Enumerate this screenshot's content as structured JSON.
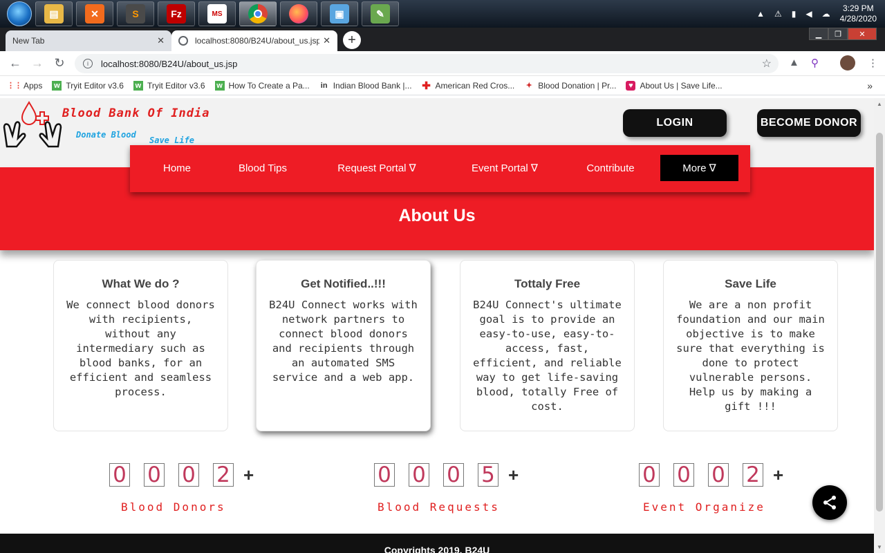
{
  "taskbar": {
    "apps": [
      {
        "name": "file-explorer-icon",
        "color": "#e8b847"
      },
      {
        "name": "xampp-icon",
        "color": "#f26b1d"
      },
      {
        "name": "sublime-icon",
        "color": "#4a4a4a"
      },
      {
        "name": "filezilla-icon",
        "color": "#bf0000"
      },
      {
        "name": "ms-app-icon",
        "color": "#1c1c1c"
      },
      {
        "name": "chrome-icon",
        "color": "#4285f4"
      },
      {
        "name": "firefox-icon",
        "color": "#ff7139"
      },
      {
        "name": "virtualbox-icon",
        "color": "#5aa6e0"
      },
      {
        "name": "paint-icon",
        "color": "#6aa84f"
      }
    ],
    "clock_time": "3:29 PM",
    "clock_date": "4/28/2020"
  },
  "browser": {
    "tabs": [
      {
        "label": "New Tab"
      },
      {
        "label": "localhost:8080/B24U/about_us.jsp"
      }
    ],
    "url": "localhost:8080/B24U/about_us.jsp",
    "bookmarks": [
      {
        "label": "Apps",
        "icon": "apps-grid-icon",
        "color": "#e94235"
      },
      {
        "label": "Tryit Editor v3.6",
        "icon": "w3-icon",
        "color": "#4caf50"
      },
      {
        "label": "Tryit Editor v3.6",
        "icon": "w3-icon",
        "color": "#4caf50"
      },
      {
        "label": "How To Create a Pa...",
        "icon": "w3-icon",
        "color": "#4caf50"
      },
      {
        "label": "Indian Blood Bank |...",
        "icon": "in-icon",
        "color": "#222222"
      },
      {
        "label": "American Red Cros...",
        "icon": "red-cross-icon",
        "color": "#e02020"
      },
      {
        "label": "Blood Donation | Pr...",
        "icon": "blood-donation-icon",
        "color": "#d32f2f"
      },
      {
        "label": "About Us | Save Life...",
        "icon": "save-life-icon",
        "color": "#d81b60"
      }
    ]
  },
  "site": {
    "brand_title": "Blood Bank Of India",
    "tag_donate": "Donate Blood",
    "tag_save": "Save Life",
    "login_label": "LOGIN",
    "donor_label": "BECOME DONOR",
    "nav": [
      {
        "label": "Home"
      },
      {
        "label": "Blood Tips"
      },
      {
        "label": "Request Portal ∇"
      },
      {
        "label": "Event Portal ∇"
      },
      {
        "label": "Contribute"
      },
      {
        "label": "More ∇"
      }
    ],
    "page_title": "About Us",
    "cards": [
      {
        "title": "What We do ?",
        "text": "We connect blood donors with recipients, without any intermediary such as blood banks, for an efficient and seamless process."
      },
      {
        "title": "Get Notified..!!!",
        "text": "B24U Connect works with network partners to connect blood donors and recipients through an automated SMS service and a web app."
      },
      {
        "title": "Tottaly Free",
        "text": "B24U Connect's ultimate goal is to provide an easy-to-use, easy-to-access, fast, efficient, and reliable way to get life-saving blood, totally Free of cost."
      },
      {
        "title": "Save Life",
        "text": "We are a non profit foundation and our main objective is to make sure that everything is done to protect vulnerable persons. Help us by making a gift !!!"
      }
    ],
    "counters": [
      {
        "digits": [
          "0",
          "0",
          "0",
          "2"
        ],
        "plus": "+",
        "label": "Blood Donors"
      },
      {
        "digits": [
          "0",
          "0",
          "0",
          "5"
        ],
        "plus": "+",
        "label": "Blood Requests"
      },
      {
        "digits": [
          "0",
          "0",
          "0",
          "2"
        ],
        "plus": "+",
        "label": "Event Organize"
      }
    ],
    "footer": "Copyrights 2019, B24U",
    "colors": {
      "brand_red": "#ee1c25",
      "digit": "#c0395c",
      "label_red": "#e02020"
    }
  }
}
